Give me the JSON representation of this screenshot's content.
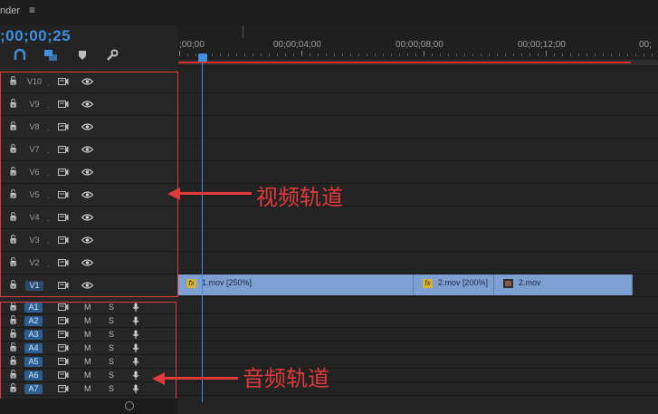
{
  "panel": {
    "tab_title": "nder",
    "menu_icon": "hamburger-icon",
    "timecode": ";00;00;25"
  },
  "toolbar": [
    "snap-icon",
    "linked-selection-icon",
    "add-marker-icon",
    "wrench-icon"
  ],
  "ruler": {
    "labels": [
      ";00;00",
      "00;00;04;00",
      "00;00;08;00",
      "00;00;12;00",
      "00;"
    ]
  },
  "video_tracks": [
    {
      "name": "V10"
    },
    {
      "name": "V9"
    },
    {
      "name": "V8"
    },
    {
      "name": "V7"
    },
    {
      "name": "V6"
    },
    {
      "name": "V5"
    },
    {
      "name": "V4"
    },
    {
      "name": "V3"
    },
    {
      "name": "V2"
    },
    {
      "name": "V1"
    }
  ],
  "audio_tracks": [
    {
      "name": "A1",
      "m": "M",
      "s": "S"
    },
    {
      "name": "A2",
      "m": "M",
      "s": "S"
    },
    {
      "name": "A3",
      "m": "M",
      "s": "S"
    },
    {
      "name": "A4",
      "m": "M",
      "s": "S"
    },
    {
      "name": "A5",
      "m": "M",
      "s": "S"
    },
    {
      "name": "A6",
      "m": "M",
      "s": "S"
    },
    {
      "name": "A7",
      "m": "M",
      "s": "S"
    }
  ],
  "clips": [
    {
      "fx": "fx",
      "label": "1.mov [250%]",
      "icon": "fx-badge-icon"
    },
    {
      "fx": "fx",
      "label": "2.mov [200%]",
      "icon": "fx-badge-icon"
    },
    {
      "fx": "",
      "label": "2.mov",
      "icon": "clip-thumb-icon"
    }
  ],
  "annotations": {
    "video": "视频轨道",
    "audio": "音频轨道"
  },
  "colors": {
    "accent": "#3d8fe0",
    "annotation": "#e03a3a",
    "clip": "#7e9fd2"
  }
}
